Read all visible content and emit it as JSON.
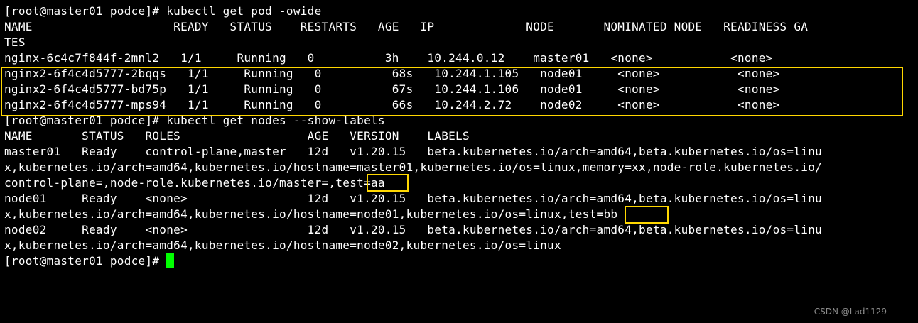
{
  "terminal": {
    "lines": [
      "[root@master01 podce]# kubectl get pod -owide",
      "NAME                    READY   STATUS    RESTARTS   AGE   IP             NODE       NOMINATED NODE   READINESS GA",
      "TES",
      "nginx-6c4c7f844f-2mnl2   1/1     Running   0          3h    10.244.0.12    master01   <none>           <none>",
      "nginx2-6f4c4d5777-2bqqs   1/1     Running   0          68s   10.244.1.105   node01     <none>           <none>",
      "nginx2-6f4c4d5777-bd75p   1/1     Running   0          67s   10.244.1.106   node01     <none>           <none>",
      "nginx2-6f4c4d5777-mps94   1/1     Running   0          66s   10.244.2.72    node02     <none>           <none>",
      "[root@master01 podce]# kubectl get nodes --show-labels",
      "NAME       STATUS   ROLES                  AGE   VERSION    LABELS",
      "master01   Ready    control-plane,master   12d   v1.20.15   beta.kubernetes.io/arch=amd64,beta.kubernetes.io/os=linu",
      "x,kubernetes.io/arch=amd64,kubernetes.io/hostname=master01,kubernetes.io/os=linux,memory=xx,node-role.kubernetes.io/",
      "control-plane=,node-role.kubernetes.io/master=,test=aa",
      "node01     Ready    <none>                 12d   v1.20.15   beta.kubernetes.io/arch=amd64,beta.kubernetes.io/os=linu",
      "x,kubernetes.io/arch=amd64,kubernetes.io/hostname=node01,kubernetes.io/os=linux,test=bb",
      "node02     Ready    <none>                 12d   v1.20.15   beta.kubernetes.io/arch=amd64,beta.kubernetes.io/os=linu",
      "x,kubernetes.io/arch=amd64,kubernetes.io/hostname=node02,kubernetes.io/os=linux"
    ],
    "prompt": "[root@master01 podce]# ",
    "colors": {
      "background": "#000000",
      "text": "#ffffff",
      "cursor": "#00ff00",
      "highlight": "#ffd700"
    }
  },
  "watermark": "CSDN @Lad1129"
}
